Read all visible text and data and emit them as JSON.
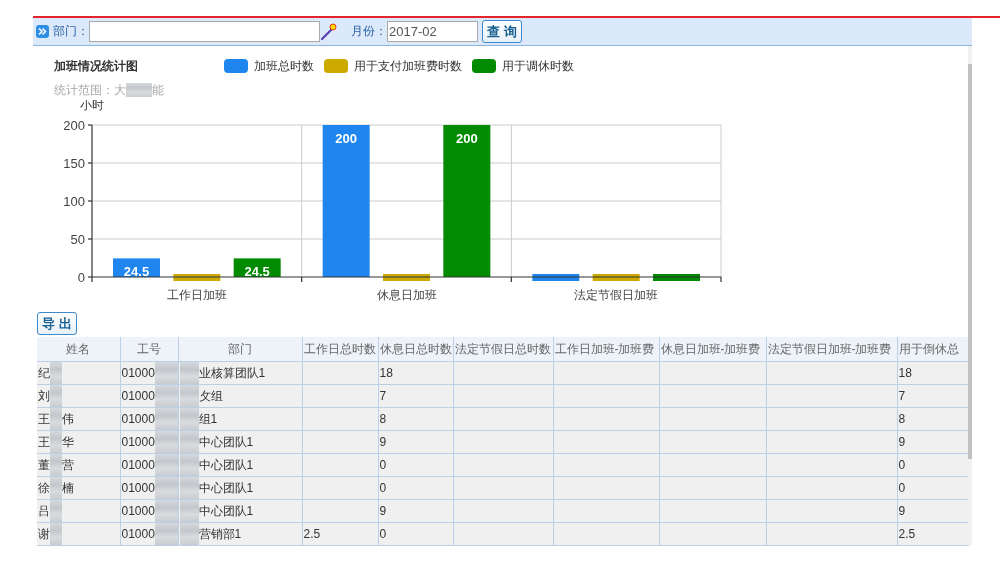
{
  "toolbar": {
    "fields": [
      {
        "kind": "picker",
        "label": "部门："
      },
      {
        "kind": "text",
        "label": "月份：",
        "value": "2017-02"
      }
    ],
    "button": "查 询"
  },
  "chart": {
    "chart_data": {
      "type": "bar",
      "title": "加班情况统计图",
      "ylabel": "小时",
      "legend": "top",
      "grid": true,
      "categories": [
        "工作日加班",
        "休息日加班",
        "法定节假日加班"
      ],
      "series": [
        {
          "name": "加班总时数",
          "color": "#1e86ee",
          "values": [
            24.5,
            200,
            0
          ],
          "value_labels": [
            "24.5",
            "200",
            null
          ]
        },
        {
          "name": "用于支付加班费时数",
          "color": "#ccaa00",
          "values": [
            0,
            0,
            0
          ]
        },
        {
          "name": "用于调休时数",
          "color": "#028a00",
          "values": [
            24.5,
            200,
            0
          ],
          "value_labels": [
            "24.5",
            "200",
            null
          ]
        }
      ],
      "ylim": [
        0,
        200
      ],
      "yticks": [
        0,
        50,
        100,
        150,
        200
      ]
    },
    "scope": [
      "统计范围：大",
      "能"
    ]
  },
  "export_button": "导 出",
  "table": {
    "columns": [
      "姓名",
      "工号",
      "部门",
      "工作日总时数",
      "休息日总时数",
      "法定节假日总时数",
      "工作日加班-加班费",
      "休息日加班-加班费",
      "法定节假日加班-加班费",
      "用于倒休总"
    ],
    "rows": [
      {
        "name": [
          "纪"
        ],
        "employee_id": "01000",
        "department": "业核算团队1",
        "restday_total": "18",
        "comp_leave_total": "18"
      },
      {
        "name": [
          "刘"
        ],
        "employee_id": "01000",
        "department": "攵组",
        "restday_total": "7",
        "comp_leave_total": "7"
      },
      {
        "name": [
          "王",
          "伟"
        ],
        "employee_id": "01000",
        "department": "组1",
        "restday_total": "8",
        "comp_leave_total": "8"
      },
      {
        "name": [
          "王",
          "华"
        ],
        "employee_id": "01000",
        "department": "中心团队1",
        "restday_total": "9",
        "comp_leave_total": "9"
      },
      {
        "name": [
          "董",
          "营"
        ],
        "employee_id": "01000",
        "department": "中心团队1",
        "restday_total": "0",
        "comp_leave_total": "0"
      },
      {
        "name": [
          "徐",
          "楠"
        ],
        "employee_id": "01000",
        "department": "中心团队1",
        "restday_total": "0",
        "comp_leave_total": "0"
      },
      {
        "name": [
          "吕"
        ],
        "employee_id": "01000",
        "department": "中心团队1",
        "restday_total": "9",
        "comp_leave_total": "9"
      },
      {
        "name": [
          "谢"
        ],
        "employee_id": "01000",
        "department": "营销部1",
        "workday_total": "2.5",
        "restday_total": "0",
        "comp_leave_total": "2.5"
      }
    ]
  }
}
